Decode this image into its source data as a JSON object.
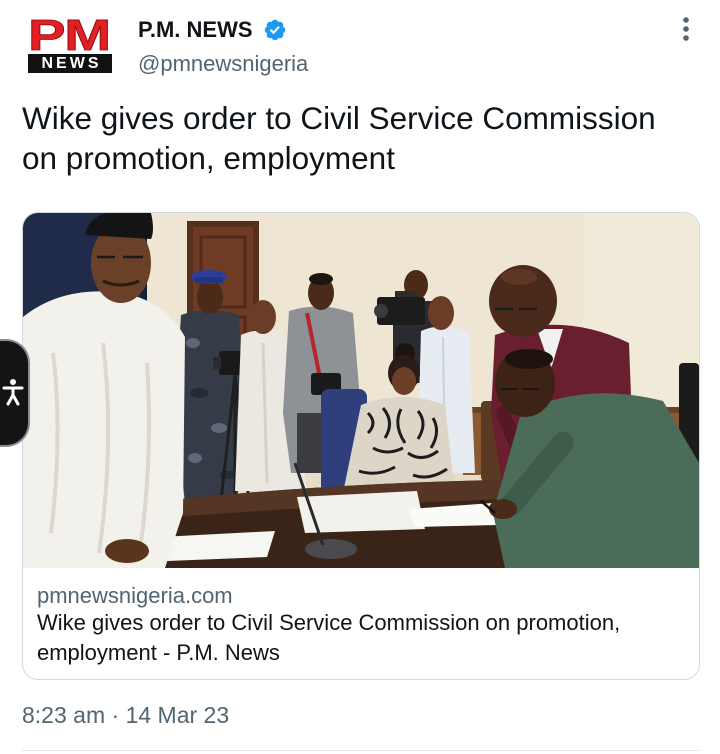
{
  "colors": {
    "text": "#0f1419",
    "secondary_text": "#536471",
    "verified_blue": "#1d9bf0",
    "brand_red": "#e31e24",
    "card_border": "#cfd9de"
  },
  "author": {
    "logo": {
      "top": "PM",
      "bottom": "NEWS"
    },
    "display_name": "P.M. NEWS",
    "handle": "@pmnewsnigeria",
    "verified_icon": "verified-badge-icon"
  },
  "more_options_icon": "more-options-icon",
  "tweet": {
    "text": "Wike gives order to Civil Service Commission on promotion, employment"
  },
  "link_card": {
    "domain": "pmnewsnigeria.com",
    "title": "Wike gives order to Civil Service Commission on promotion, employment - P.M. News"
  },
  "timestamp": {
    "time": "8:23 am",
    "separator": "·",
    "date": "14 Mar 23"
  },
  "accessibility_button": {
    "icon": "accessibility-icon"
  }
}
